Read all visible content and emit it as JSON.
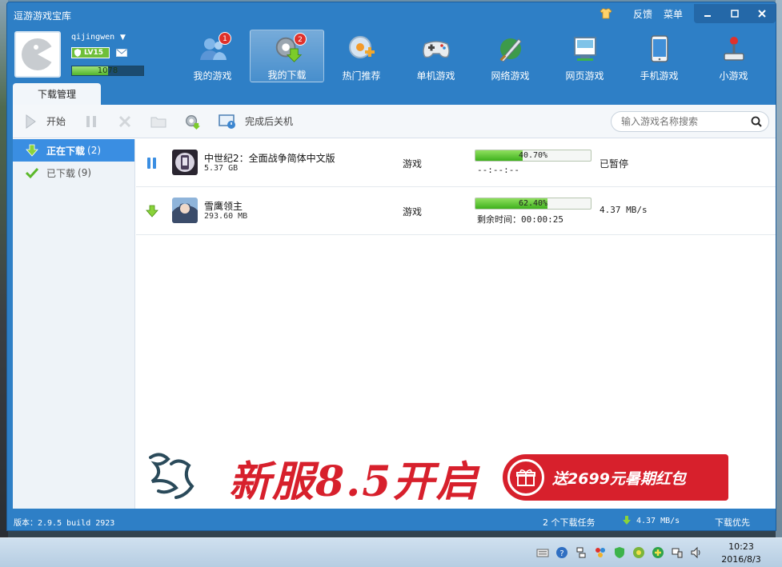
{
  "window": {
    "title": "逗游游戏宝库",
    "right_links": [
      "反馈",
      "菜单"
    ]
  },
  "user": {
    "name": "qijingwen",
    "level": "LV15",
    "exp": "1078",
    "exp_fraction": 0.5
  },
  "nav": {
    "items": [
      {
        "label": "我的游戏",
        "badge": "1",
        "icon": "users-icon"
      },
      {
        "label": "我的下载",
        "badge": "2",
        "icon": "download-gear-icon",
        "active": true
      },
      {
        "label": "热门推荐",
        "icon": "hot-recommend-icon"
      },
      {
        "label": "单机游戏",
        "icon": "gamepad-icon"
      },
      {
        "label": "网络游戏",
        "icon": "sword-icon"
      },
      {
        "label": "网页游戏",
        "icon": "web-monitor-icon"
      },
      {
        "label": "手机游戏",
        "icon": "phone-icon"
      },
      {
        "label": "小游戏",
        "icon": "joystick-icon"
      }
    ]
  },
  "tab": {
    "label": "下载管理"
  },
  "toolbar": {
    "start_label": "开始",
    "shutdown_label": "完成后关机",
    "search_placeholder": "输入游戏名称搜索"
  },
  "sidebar": {
    "items": [
      {
        "label": "正在下载",
        "count": "(2)",
        "active": true
      },
      {
        "label": "已下载",
        "count": "(9)"
      }
    ]
  },
  "downloads": [
    {
      "name": "中世纪2：全面战争简体中文版",
      "size": "5.37 GB",
      "type": "游戏",
      "progress": 40.7,
      "progress_label": "40.70%",
      "sub": "--:--:--",
      "status": "已暂停"
    },
    {
      "name": "雪鹰领主",
      "size": "293.60 MB",
      "type": "游戏",
      "progress": 62.4,
      "progress_label": "62.40%",
      "sub": "剩余时间：00:00:25",
      "status": "4.37 MB/s"
    }
  ],
  "banner": {
    "headline": "新服8.5开启",
    "ribbon": "送2699元暑期红包"
  },
  "statusbar": {
    "version": "版本：2.9.5 build 2923",
    "tasks": "2 个下载任务",
    "speed": "4.37 MB/s",
    "priority": "下载优先"
  },
  "taskbar": {
    "time": "10:23",
    "date": "2016/8/3"
  },
  "colors": {
    "window_blue": "#2e7fc6",
    "progress_green": "#3fb11e",
    "banner_red": "#d7202c",
    "active_blue": "#3a8ee2"
  }
}
